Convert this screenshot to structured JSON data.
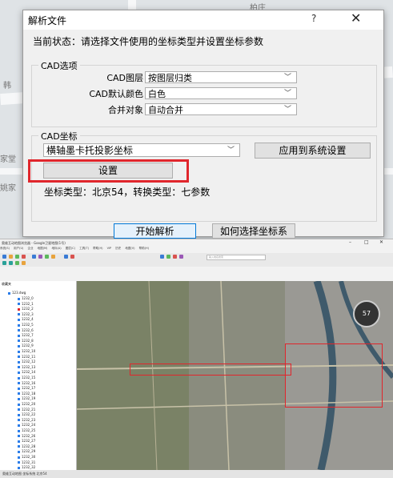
{
  "dialog": {
    "title": "解析文件",
    "help": "?",
    "close": "✕",
    "status": "当前状态：请选择文件使用的坐标类型并设置坐标参数",
    "cad_options": {
      "group_label": "CAD选项",
      "layer_label": "CAD图层",
      "layer_value": "按图层归类",
      "color_label": "CAD默认颜色",
      "color_value": "白色",
      "merge_label": "合并对象",
      "merge_value": "自动合并"
    },
    "cad_coord": {
      "group_label": "CAD坐标",
      "coord_type_value": "横轴墨卡托投影坐标",
      "apply_button": "应用到系统设置",
      "settings_button": "设置",
      "info": "坐标类型：北京54，转换类型：七参数"
    },
    "start_button": "开始解析",
    "how_button": "如何选择坐标系"
  },
  "background": {
    "labels": [
      "柏庄",
      "韩",
      "家堂",
      "姚家"
    ]
  },
  "app": {
    "title": "奥维互动地图浏览器 - Google卫星地图(1号)",
    "window_controls": [
      "–",
      "□",
      "✕"
    ],
    "menu": [
      "系统(S)",
      "用户(U)",
      "企业",
      "地图(M)",
      "地标(A)",
      "图层(C)",
      "工具(T)",
      "帮助(H)",
      "VIP",
      "历史",
      "地图(V)",
      "帮助(H)"
    ],
    "search_placeholder": "输入地名搜索",
    "sidebar_title": "收藏夹",
    "tree_root": "123.dwg",
    "tree_items": [
      "1232_0",
      "1232_1",
      "1232_2",
      "1232_3",
      "1232_4",
      "1232_5",
      "1232_6",
      "1232_7",
      "1232_8",
      "1232_9",
      "1232_10",
      "1232_11",
      "1232_12",
      "1232_13",
      "1232_14",
      "1232_15",
      "1232_16",
      "1232_17",
      "1232_18",
      "1232_19",
      "1232_20",
      "1232_21",
      "1232_22",
      "1232_23",
      "1232_24",
      "1232_25",
      "1232_26",
      "1232_27",
      "1232_28",
      "1232_29",
      "1232_30",
      "1232_31",
      "1232_32"
    ],
    "compass_value": "57",
    "status_text": "奥维互动地图  坐标系统  北京54"
  },
  "colors": {
    "highlight": "#e0262c",
    "map": "#6c735b"
  }
}
